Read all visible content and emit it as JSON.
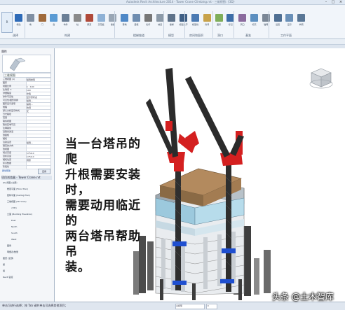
{
  "titlebar": {
    "title": "Autodesk Revit Architecture 2014 - Tower Crane Climbing.rvt - 三维视图: {3D}"
  },
  "ribbon": {
    "app_button": "R",
    "buttons": [
      {
        "label": "修改",
        "color": "#2e6bb8"
      },
      {
        "label": "墙",
        "color": "#7f8fa3"
      },
      {
        "label": "门",
        "color": "#a06a3b"
      },
      {
        "label": "窗",
        "color": "#5a9bd4"
      },
      {
        "label": "构件",
        "color": "#6b7f96"
      },
      {
        "label": "柱",
        "color": "#8a8a8a"
      },
      {
        "label": "屋顶",
        "color": "#b04a3a"
      },
      {
        "label": "天花板",
        "color": "#8fb2d6"
      },
      {
        "label": "楼板",
        "color": "#9aa7b5"
      },
      {
        "label": "幕墙",
        "color": "#4e88c7"
      },
      {
        "label": "竖梃",
        "color": "#6f8db0"
      },
      {
        "label": "栏杆",
        "color": "#777777"
      },
      {
        "label": "坡道",
        "color": "#8c9aa8"
      },
      {
        "label": "楼梯",
        "color": "#5f738a"
      },
      {
        "label": "模型文字",
        "color": "#3f5f85"
      },
      {
        "label": "模型线",
        "color": "#4b7ab3"
      },
      {
        "label": "房间",
        "color": "#c8a24a"
      },
      {
        "label": "面积",
        "color": "#7fae5a"
      },
      {
        "label": "标记",
        "color": "#3d6ea8"
      },
      {
        "label": "洞口",
        "color": "#8b6b9e"
      },
      {
        "label": "标高",
        "color": "#5c8fc0"
      },
      {
        "label": "轴网",
        "color": "#7b8796"
      },
      {
        "label": "设置",
        "color": "#4f6f93"
      },
      {
        "label": "显示",
        "color": "#6a90b8"
      },
      {
        "label": "参照",
        "color": "#5a7796"
      }
    ],
    "panels": [
      "选择",
      "构建",
      "楼梯坡道",
      "模型",
      "房间和面积",
      "洞口",
      "基准",
      "工作平面"
    ]
  },
  "properties": {
    "header": "属性",
    "type_name": "三维视图",
    "rows": [
      {
        "key": "三维视图 (1)",
        "value": "编辑类型"
      },
      {
        "key": "图形",
        "value": ""
      },
      {
        "key": "视图比例",
        "value": "1 : 100"
      },
      {
        "key": "比例值 1:",
        "value": "100"
      },
      {
        "key": "详细程度",
        "value": "中等"
      },
      {
        "key": "零件可见性",
        "value": "显示原状态"
      },
      {
        "key": "可见性/图形替换",
        "value": "编辑..."
      },
      {
        "key": "图形显示选项",
        "value": "编辑..."
      },
      {
        "key": "规程",
        "value": "协调"
      },
      {
        "key": "默认分析显示样式",
        "value": "无"
      },
      {
        "key": "日光路径",
        "value": ""
      },
      {
        "key": "范围",
        "value": ""
      },
      {
        "key": "裁剪视图",
        "value": ""
      },
      {
        "key": "裁剪区域可见",
        "value": ""
      },
      {
        "key": "注释裁剪",
        "value": ""
      },
      {
        "key": "远裁剪激活",
        "value": ""
      },
      {
        "key": "剖面框",
        "value": ""
      },
      {
        "key": "相机",
        "value": ""
      },
      {
        "key": "渲染设置",
        "value": "编辑..."
      },
      {
        "key": "锁定的方向",
        "value": ""
      },
      {
        "key": "透视图",
        "value": ""
      },
      {
        "key": "视点高度",
        "value": "1750.0"
      },
      {
        "key": "目标高度",
        "value": "1750.0"
      },
      {
        "key": "相机位置",
        "value": "调整"
      },
      {
        "key": "标识数据",
        "value": ""
      },
      {
        "key": "阶段化",
        "value": ""
      }
    ],
    "help_link": "属性帮助",
    "apply_label": "应用"
  },
  "browser": {
    "header": "项目浏览器 - Tower Crane.rvt",
    "items": [
      "[0] 视图 (全部)",
      "楼层平面 (Floor Plan)",
      "结构平面 (Ceiling Plan)",
      "三维视图 (3D View)",
      "{3D}",
      "立面 (Building Elevation)",
      "East",
      "North",
      "South",
      "West",
      "图例",
      "明细表/数量",
      "图纸 (全部)",
      "族",
      "组",
      "Revit 链接"
    ]
  },
  "viewport": {
    "caption_lines": [
      "当一台塔吊的爬",
      "升根需要安装时，",
      "需要动用临近的",
      "两台塔吊帮助吊",
      "装。"
    ]
  },
  "statusbar": {
    "text": "单击可进行选择；按 Tab 键并单击可选择其他项目；",
    "model_field": "主模型",
    "zoom": ":0"
  },
  "watermark": "头条 @土木智库",
  "colors": {
    "crane_red": "#d42020",
    "crane_dark": "#2f2f2f",
    "facade_blue": "#9cc9dd",
    "platform_blue": "#1f4fd0"
  }
}
